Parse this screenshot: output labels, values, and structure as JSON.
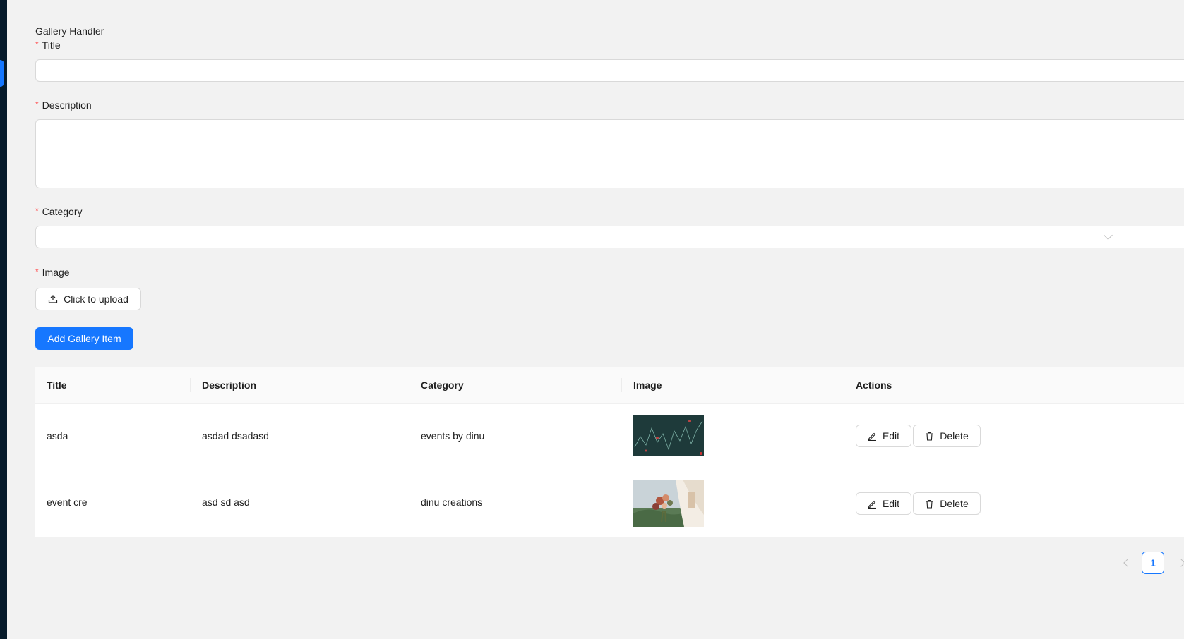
{
  "page_title": "Gallery Handler",
  "form": {
    "title_label": "Title",
    "title_value": "",
    "description_label": "Description",
    "description_value": "",
    "category_label": "Category",
    "category_value": "",
    "image_label": "Image",
    "upload_label": "Click to upload",
    "submit_label": "Add Gallery Item",
    "required_marker": "*"
  },
  "table": {
    "columns": [
      "Title",
      "Description",
      "Category",
      "Image",
      "Actions"
    ],
    "rows": [
      {
        "title": "asda",
        "description": "asdad dsadasd",
        "category": "events by dinu",
        "image": "chart-thumbnail",
        "edit": "Edit",
        "delete": "Delete"
      },
      {
        "title": "event cre",
        "description": "asd sd asd",
        "category": "dinu creations",
        "image": "bouquet-thumbnail",
        "edit": "Edit",
        "delete": "Delete"
      }
    ]
  },
  "pagination": {
    "current_page": "1"
  },
  "colors": {
    "primary": "#1677ff",
    "required": "#ff4d4f",
    "sidebar": "#071b2b"
  },
  "icons": [
    "upload-icon",
    "edit-icon",
    "delete-icon",
    "chevron-down-icon",
    "prev-page-icon",
    "next-page-icon"
  ]
}
